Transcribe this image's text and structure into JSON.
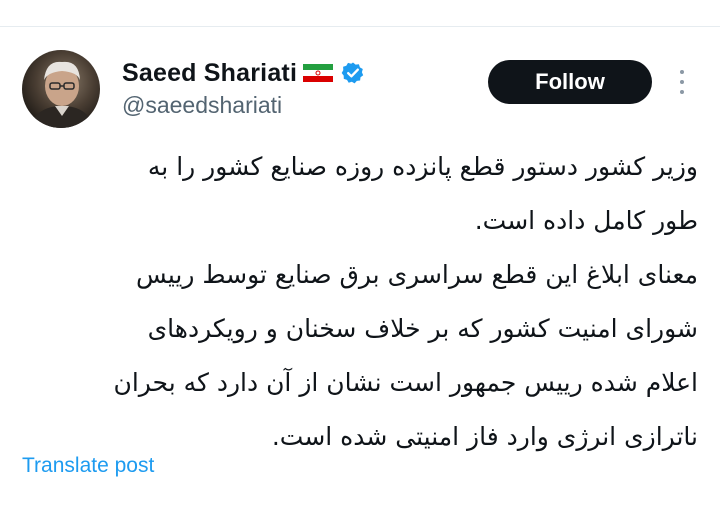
{
  "author": {
    "name": "Saeed Shariati",
    "handle": "@saeedshariati",
    "flag_icon": "iran-flag-icon",
    "verified_icon": "verified-badge-icon",
    "verified_color": "#1d9bf0"
  },
  "actions": {
    "follow_label": "Follow",
    "more_icon": "more-options-icon"
  },
  "tweet": {
    "lines": [
      "وزیر کشور دستور قطع پانزده روزه صنایع کشور را به",
      "طور کامل داده است.",
      "معنای ابلاغ این قطع سراسری برق صنایع توسط رییس",
      "شورای امنیت کشور که بر خلاف سخنان و رویکردهای",
      "اعلام شده رییس جمهور است نشان از آن دارد که بحران",
      "ناترازی انرژی وارد فاز امنیتی شده است."
    ]
  },
  "footer": {
    "translate_label": "Translate post"
  },
  "colors": {
    "text": "#0f1419",
    "secondary": "#536471",
    "link": "#1d9bf0",
    "button_bg": "#0f1419"
  }
}
